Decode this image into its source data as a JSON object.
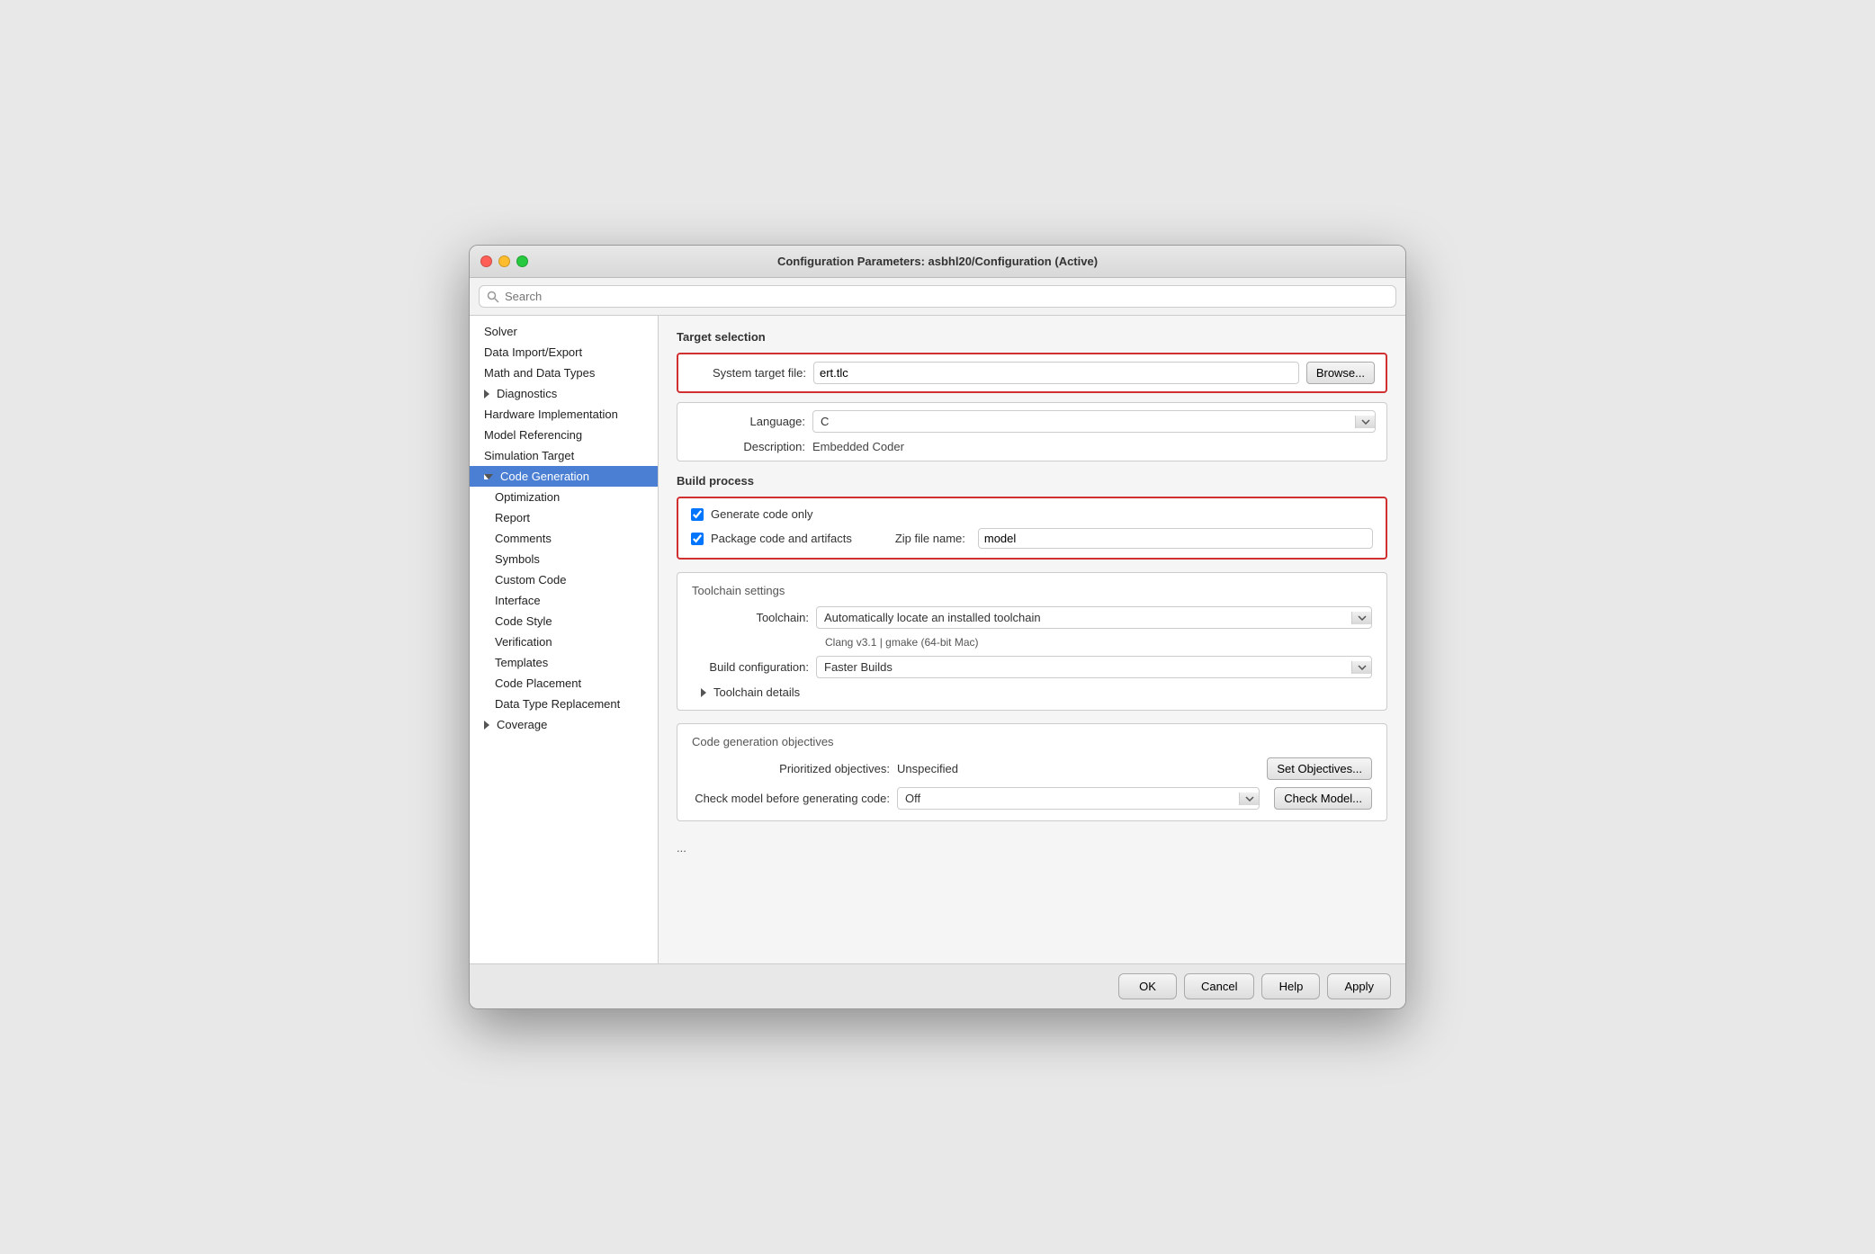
{
  "window": {
    "title": "Configuration Parameters: asbhl20/Configuration (Active)"
  },
  "search": {
    "placeholder": "Search"
  },
  "sidebar": {
    "items": [
      {
        "id": "solver",
        "label": "Solver",
        "indent": 0,
        "active": false,
        "triangle": null
      },
      {
        "id": "data-import-export",
        "label": "Data Import/Export",
        "indent": 0,
        "active": false,
        "triangle": null
      },
      {
        "id": "math-data-types",
        "label": "Math and Data Types",
        "indent": 0,
        "active": false,
        "triangle": null
      },
      {
        "id": "diagnostics",
        "label": "Diagnostics",
        "indent": 0,
        "active": false,
        "triangle": "right"
      },
      {
        "id": "hardware-impl",
        "label": "Hardware Implementation",
        "indent": 0,
        "active": false,
        "triangle": null
      },
      {
        "id": "model-referencing",
        "label": "Model Referencing",
        "indent": 0,
        "active": false,
        "triangle": null
      },
      {
        "id": "simulation-target",
        "label": "Simulation Target",
        "indent": 0,
        "active": false,
        "triangle": null
      },
      {
        "id": "code-generation",
        "label": "Code Generation",
        "indent": 0,
        "active": true,
        "triangle": "down"
      },
      {
        "id": "optimization",
        "label": "Optimization",
        "indent": 1,
        "active": false,
        "triangle": null
      },
      {
        "id": "report",
        "label": "Report",
        "indent": 1,
        "active": false,
        "triangle": null
      },
      {
        "id": "comments",
        "label": "Comments",
        "indent": 1,
        "active": false,
        "triangle": null
      },
      {
        "id": "symbols",
        "label": "Symbols",
        "indent": 1,
        "active": false,
        "triangle": null
      },
      {
        "id": "custom-code",
        "label": "Custom Code",
        "indent": 1,
        "active": false,
        "triangle": null
      },
      {
        "id": "interface",
        "label": "Interface",
        "indent": 1,
        "active": false,
        "triangle": null
      },
      {
        "id": "code-style",
        "label": "Code Style",
        "indent": 1,
        "active": false,
        "triangle": null
      },
      {
        "id": "verification",
        "label": "Verification",
        "indent": 1,
        "active": false,
        "triangle": null
      },
      {
        "id": "templates",
        "label": "Templates",
        "indent": 1,
        "active": false,
        "triangle": null
      },
      {
        "id": "code-placement",
        "label": "Code Placement",
        "indent": 1,
        "active": false,
        "triangle": null
      },
      {
        "id": "data-type-replacement",
        "label": "Data Type Replacement",
        "indent": 1,
        "active": false,
        "triangle": null
      },
      {
        "id": "coverage",
        "label": "Coverage",
        "indent": 0,
        "active": false,
        "triangle": "right"
      }
    ]
  },
  "content": {
    "target_selection": {
      "header": "Target selection",
      "system_target_file_label": "System target file:",
      "system_target_file_value": "ert.tlc",
      "browse_label": "Browse...",
      "language_label": "Language:",
      "language_value": "C",
      "description_label": "Description:",
      "description_value": "Embedded Coder"
    },
    "build_process": {
      "header": "Build process",
      "generate_code_only_label": "Generate code only",
      "generate_code_only_checked": true,
      "package_code_label": "Package code and artifacts",
      "package_code_checked": true,
      "zip_file_label": "Zip file name:",
      "zip_file_value": "model"
    },
    "toolchain_settings": {
      "header": "Toolchain settings",
      "toolchain_label": "Toolchain:",
      "toolchain_value": "Automatically locate an installed toolchain",
      "toolchain_sub": "Clang v3.1 | gmake (64-bit Mac)",
      "build_config_label": "Build configuration:",
      "build_config_value": "Faster Builds",
      "details_label": "Toolchain details"
    },
    "code_gen_objectives": {
      "header": "Code generation objectives",
      "prioritized_label": "Prioritized objectives:",
      "prioritized_value": "Unspecified",
      "set_obj_btn": "Set Objectives...",
      "check_model_label": "Check model before generating code:",
      "check_model_value": "Off",
      "check_model_btn": "Check Model..."
    },
    "ellipsis": "..."
  },
  "bottom_bar": {
    "ok_label": "OK",
    "cancel_label": "Cancel",
    "help_label": "Help",
    "apply_label": "Apply"
  }
}
